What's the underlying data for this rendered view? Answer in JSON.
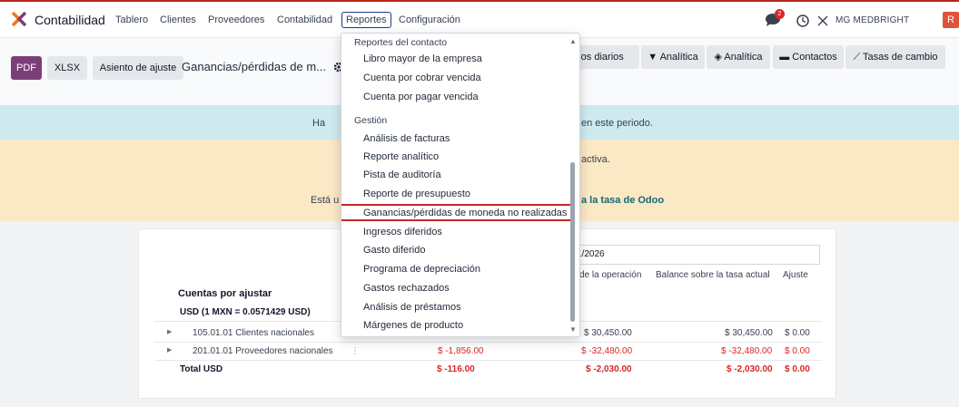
{
  "navbar": {
    "app_name": "Contabilidad",
    "items": [
      "Tablero",
      "Clientes",
      "Proveedores",
      "Contabilidad",
      "Reportes",
      "Configuración"
    ],
    "active_item": "Reportes",
    "chat_badge": "2",
    "company": "MG MEDBRIGHT",
    "user_initial": "R"
  },
  "control": {
    "pdf_label": "PDF",
    "xlsx_label": "XLSX",
    "asiento_label": "Asiento de ajuste",
    "report_title": "Ganancias/pérdidas de m...",
    "right_buttons": {
      "libros": "los diarios",
      "analitica1": "Analítica",
      "analitica2": "Analítica",
      "contactos": "Contactos",
      "tasas": "Tasas de cambio"
    }
  },
  "banners": {
    "blue_left": "Ha",
    "blue_right": "en este periodo.",
    "yellow_line1": "activa.",
    "yellow_left": "Está u",
    "yellow_link": "a la tasa de Odoo"
  },
  "table": {
    "date_value": "1/2026",
    "col_operation": "de la operación",
    "col_balance": "Balance sobre la tasa actual",
    "col_ajuste": "Ajuste",
    "cuentas_header": "Cuentas por ajustar",
    "group_label": "USD (1 MXN = 0.0571429 USD)",
    "rows": [
      {
        "account": "105.01.01 Clientes nacionales",
        "val1": "",
        "operation": "$ 30,450.00",
        "balance": "$ 30,450.00",
        "ajuste": "$ 0.00"
      },
      {
        "account": "201.01.01 Proveedores nacionales",
        "val1": "$ -1,856.00",
        "operation": "$ -32,480.00",
        "balance": "$ -32,480.00",
        "ajuste": "$ 0.00"
      }
    ],
    "total": {
      "label": "Total USD",
      "val1": "$ -116.00",
      "operation": "$ -2,030.00",
      "balance": "$ -2,030.00",
      "ajuste": "$ 0.00"
    }
  },
  "dropdown": {
    "section1": "Reportes del contacto",
    "items1": [
      "Libro mayor de la empresa",
      "Cuenta por cobrar vencida",
      "Cuenta por pagar vencida"
    ],
    "section2": "Gestión",
    "items2": [
      "Análisis de facturas",
      "Reporte analítico",
      "Pista de auditoría",
      "Reporte de presupuesto",
      "Ganancias/pérdidas de moneda no realizadas",
      "Ingresos diferidos",
      "Gasto diferido",
      "Programa de depreciación",
      "Gastos rechazados",
      "Análisis de préstamos",
      "Márgenes de producto"
    ],
    "highlighted": "Ganancias/pérdidas de moneda no realizadas"
  },
  "colors": {
    "pdf_button": "#7b3f77",
    "highlight_border": "#c62828",
    "negative": "#dc2626",
    "banner_blue": "#cfe9f0",
    "banner_yellow": "#fbe8c5"
  }
}
